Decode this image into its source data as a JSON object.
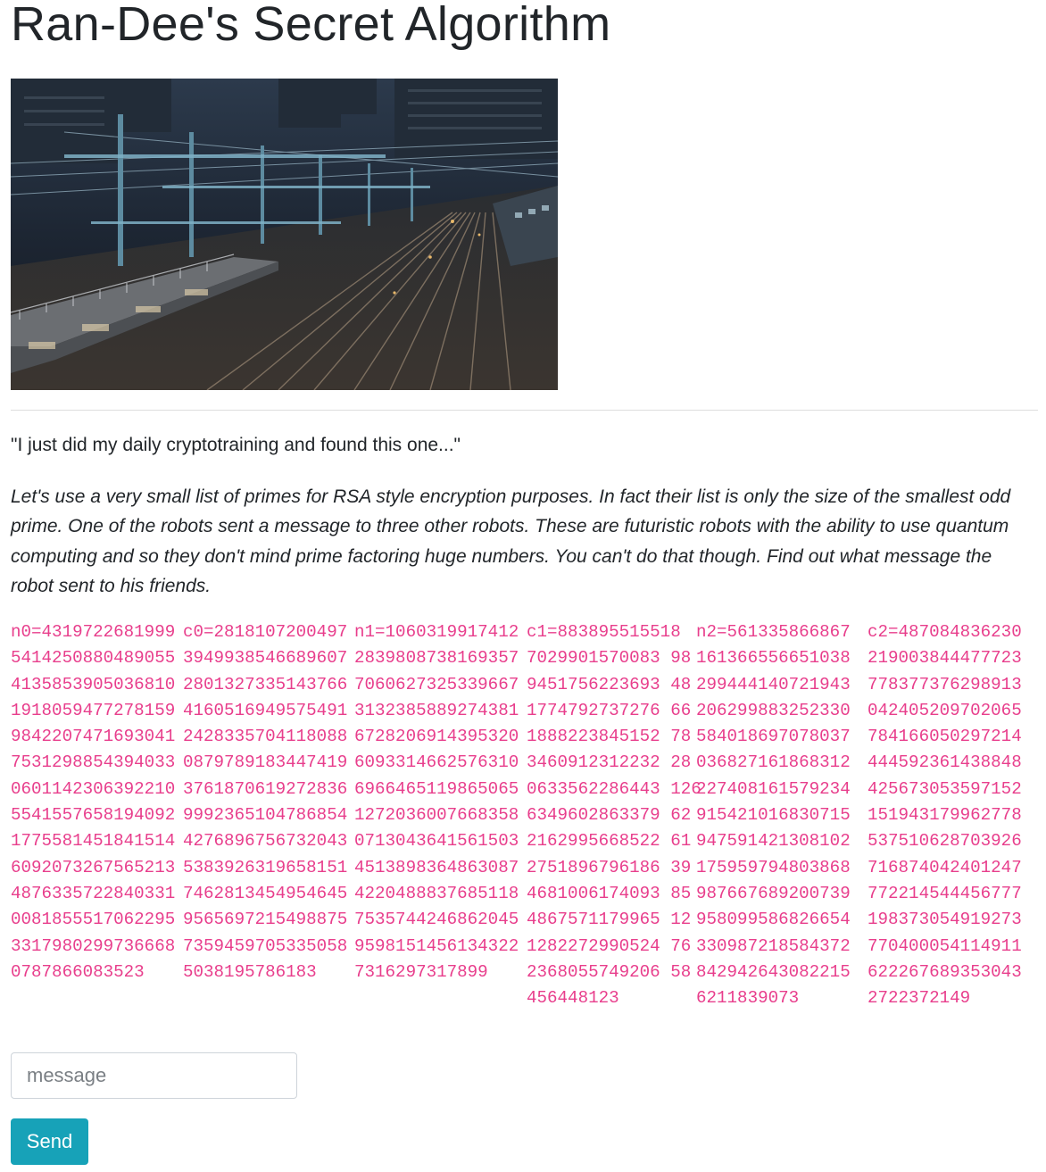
{
  "page": {
    "title": "Ran-Dee's Secret Algorithm"
  },
  "intro": {
    "quote": "\"I just did my daily cryptotraining and found this one...\"",
    "description": "Let's use a very small list of primes for RSA style encryption purposes. In fact their list is only the size of the smallest odd prime. One of the robots sent a message to three other robots. These are futuristic robots with the ability to use quantum computing and so they don't mind prime factoring huge numbers. You can't do that though. Find out what message the robot sent to his friends."
  },
  "ciphertext_table": {
    "columns": [
      {
        "name": "n0",
        "lines": [
          "n0=4319722681999",
          "5414250880489055",
          "4135853905036810",
          "1918059477278159",
          "9842207471693041",
          "7531298854394033",
          "0601142306392210",
          "5541557658194092",
          "1775581451841514",
          "6092073267565213",
          "4876335722840331",
          "0081855517062295",
          "3317980299736668",
          "0787866083523"
        ]
      },
      {
        "name": "c0",
        "lines": [
          "c0=2818107200497",
          "3949938546689607",
          "2801327335143766",
          "4160516949575491",
          "2428335704118088",
          "0879789183447419",
          "3761870619272836",
          "9992365104786854",
          "4276896756732043",
          "5383926319658151",
          "7462813454954645",
          "9565697215498875",
          "7359459705335058",
          "5038195786183"
        ]
      },
      {
        "name": "n1",
        "lines": [
          "n1=1060319917412",
          "2839808738169357",
          "7060627325339667",
          "3132385889274381",
          "6728206914395320",
          "6093314662576310",
          "6966465119865065",
          "1272036007668358",
          "0713043641561503",
          "4513898364863087",
          "4220488837685118",
          "7535744246862045",
          "9598151456134322",
          "7316297317899"
        ]
      },
      {
        "name": "c1",
        "lines": [
          "c1=883895515518",
          "7029901570083 98",
          "9451756223693 48",
          "1774792737276 66",
          "1888223845152 78",
          "3460912312232 28",
          "0633562286443 126",
          "6349602863379 62",
          "2162995668522 61",
          "2751896796186 39",
          "4681006174093 85",
          "4867571179965 12",
          "1282272990524 76",
          "2368055749206 58",
          "456448123"
        ]
      },
      {
        "name": "n2",
        "lines": [
          "n2=561335866867",
          "161366556651038",
          "299444140721943",
          "206299883252330",
          "584018697078037",
          "036827161868312",
          "227408161579234",
          "915421016830715",
          "947591421308102",
          "175959794803868",
          "987667689200739",
          "958099586826654",
          "330987218584372",
          "842942643082215",
          "6211839073"
        ]
      },
      {
        "name": "c2",
        "lines": [
          "c2=487084836230",
          "219003844477723",
          "778377376298913",
          "042405209702065",
          "784166050297214",
          "444592361438848",
          "425673053597152",
          "151943179962778",
          "537510628703926",
          "716874042401247",
          "772214544456777",
          "198373054919273",
          "770400054114911",
          "622267689353043",
          "2722372149"
        ]
      }
    ]
  },
  "form": {
    "message_placeholder": "message",
    "message_value": "",
    "send_label": "Send"
  },
  "colors": {
    "code_text": "#e83e8c",
    "send_button_bg": "#17a2b8",
    "send_button_text": "#ffffff",
    "heading_text": "#212529",
    "divider": "#dddddd",
    "input_border": "#ced4da"
  },
  "photo": {
    "icon": "rail-yard-photo"
  }
}
